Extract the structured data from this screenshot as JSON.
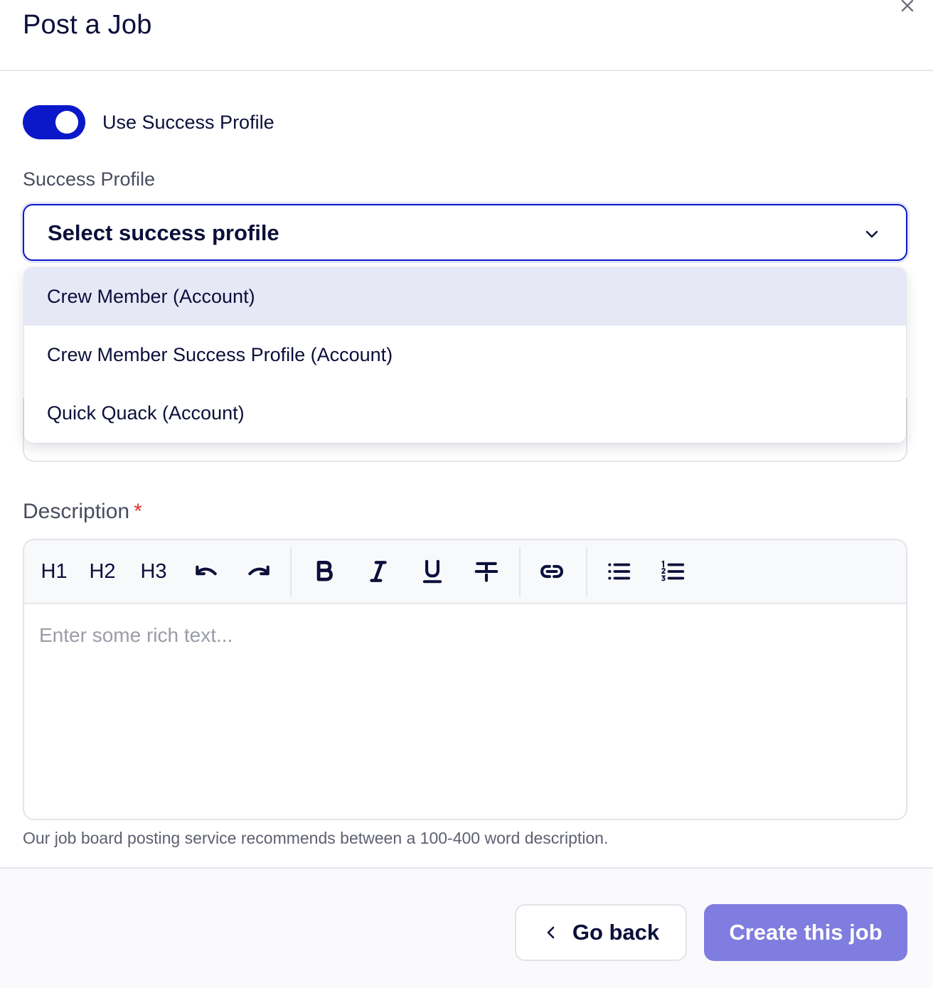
{
  "header": {
    "title": "Post a Job",
    "close_icon": "close-icon"
  },
  "toggle": {
    "label": "Use Success Profile",
    "on": true
  },
  "success_profile": {
    "label": "Success Profile",
    "selected_value": "Select success profile",
    "options": [
      "Crew Member (Account)",
      "Crew Member Success Profile (Account)",
      "Quick Quack (Account)"
    ],
    "highlighted_option": 0
  },
  "description": {
    "label": "Description",
    "required_marker": "*",
    "toolbar": {
      "h1": "H1",
      "h2": "H2",
      "h3": "H3",
      "icons": [
        "undo-icon",
        "redo-icon",
        "bold-icon",
        "italic-icon",
        "underline-icon",
        "strikethrough-icon",
        "link-icon",
        "bulleted-list-icon",
        "numbered-list-icon"
      ]
    },
    "placeholder": "Enter some rich text...",
    "hint": "Our job board posting service recommends between a 100-400 word description."
  },
  "footer": {
    "back_label": "Go back",
    "create_label": "Create this job"
  },
  "colors": {
    "accent": "#0b18c9",
    "create_button": "#7f7ddf",
    "highlight": "#e6e8f6",
    "required": "#e0342c"
  }
}
